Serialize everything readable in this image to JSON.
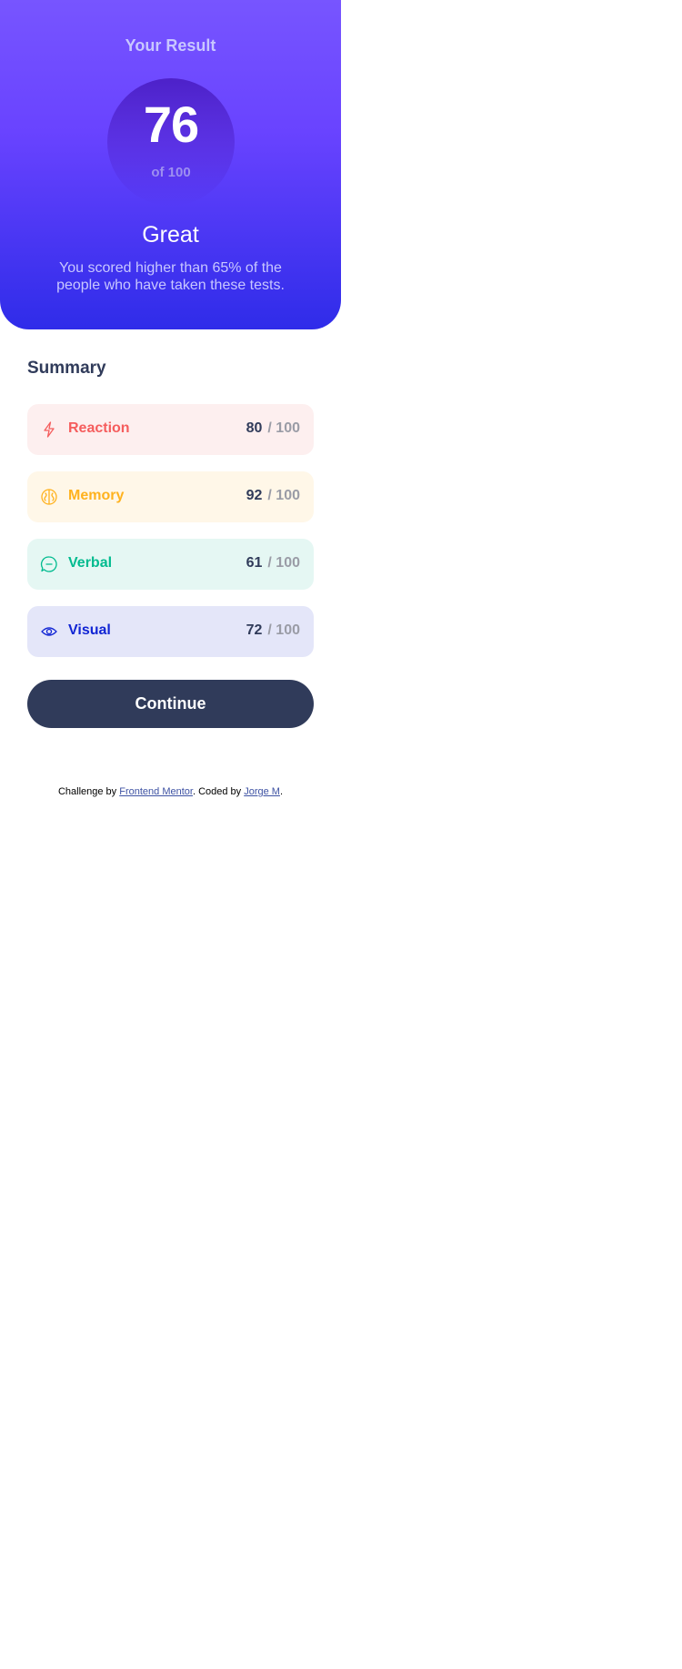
{
  "result": {
    "title": "Your Result",
    "score": "76",
    "of_label": "of 100",
    "grade": "Great",
    "description": "You scored higher than 65% of the people who have taken these tests.",
    "gradient_colors": [
      "#7755ff",
      "#2f2ce9"
    ]
  },
  "summary": {
    "title": "Summary",
    "items": [
      {
        "label": "Reaction",
        "score": "80",
        "max": "/ 100",
        "icon": "lightning-icon",
        "color": "#f55d5d",
        "bg": "#fdefef"
      },
      {
        "label": "Memory",
        "score": "92",
        "max": "/ 100",
        "icon": "brain-icon",
        "color": "#ffb21e",
        "bg": "#fff7e8"
      },
      {
        "label": "Verbal",
        "score": "61",
        "max": "/ 100",
        "icon": "chat-bubble-icon",
        "color": "#00bb8f",
        "bg": "#e5f7f3"
      },
      {
        "label": "Visual",
        "score": "72",
        "max": "/ 100",
        "icon": "eye-icon",
        "color": "#1125d4",
        "bg": "#e4e6f9"
      }
    ],
    "continue_label": "Continue"
  },
  "attribution": {
    "prefix": "Challenge by ",
    "challenge_link": "Frontend Mentor",
    "middle": ". Coded by ",
    "author_link": "Jorge M",
    "suffix": "."
  }
}
